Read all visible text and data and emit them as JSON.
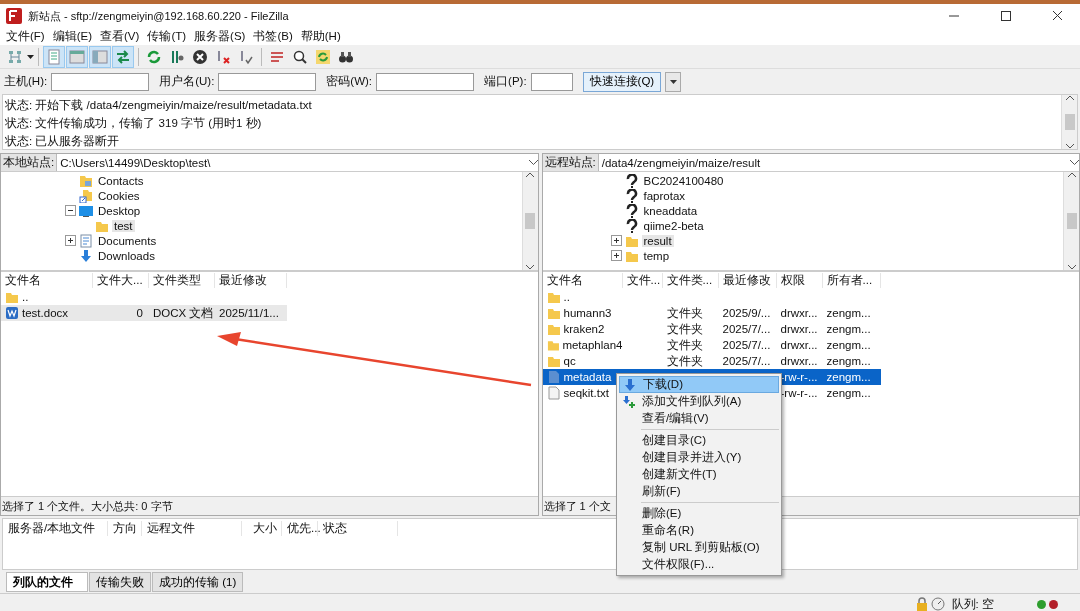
{
  "window": {
    "title": "新站点 - sftp://zengmeiyin@192.168.60.220 - FileZilla"
  },
  "menu": [
    "文件(F)",
    "编辑(E)",
    "查看(V)",
    "传输(T)",
    "服务器(S)",
    "书签(B)",
    "帮助(H)"
  ],
  "toolbar": [
    {
      "pressed": false
    },
    {
      "pressed": true
    },
    {
      "pressed": true
    },
    {
      "pressed": true
    },
    {
      "pressed": true
    },
    {
      "pressed": false
    },
    {
      "pressed": false
    },
    {
      "pressed": false
    },
    {
      "pressed": false
    },
    {
      "pressed": false
    },
    {
      "pressed": false
    },
    {
      "pressed": false
    },
    {
      "pressed": false
    },
    {
      "pressed": false
    }
  ],
  "quickconnect": {
    "fields": [
      {
        "label": "主机(H):"
      },
      {
        "label": "用户名(U):"
      },
      {
        "label": "密码(W):"
      },
      {
        "label": "端口(P):"
      }
    ],
    "button": "快速连接(Q)"
  },
  "log": [
    "状态: 开始下载 /data4/zengmeiyin/maize/result/metadata.txt",
    "状态: 文件传输成功，传输了 319 字节 (用时1 秒)",
    "状态: 已从服务器断开"
  ],
  "local": {
    "site_label": "本地站点:",
    "path": "C:\\Users\\14499\\Desktop\\test\\",
    "tree": [
      {
        "label": "Contacts",
        "kind": "contacts",
        "selected": false
      },
      {
        "label": "Cookies",
        "kind": "shortcut",
        "selected": false
      },
      {
        "label": "Desktop",
        "kind": "desktop",
        "expanded": true,
        "selected": false,
        "children": [
          {
            "label": "test",
            "kind": "folder",
            "selected": true
          }
        ]
      },
      {
        "label": "Documents",
        "kind": "document",
        "expanded": false,
        "selected": false
      },
      {
        "label": "Downloads",
        "kind": "download",
        "selected": false
      }
    ],
    "columns": [
      "文件名",
      "文件大...",
      "文件类型",
      "最近修改"
    ],
    "rows": [
      {
        "kind": "folder",
        "selected": false,
        "cells": [
          ".."
        ]
      },
      {
        "kind": "word",
        "selected": true,
        "cells": [
          "test.docx",
          "0",
          "DOCX 文档",
          "2025/11/1..."
        ]
      }
    ],
    "status": "选择了 1 个文件。大小总共: 0 字节"
  },
  "remote": {
    "site_label": "远程站点:",
    "path": "/data4/zengmeiyin/maize/result",
    "tree": [
      {
        "label": "BC2024100480",
        "kind": "unknown",
        "selected": false
      },
      {
        "label": "faprotax",
        "kind": "unknown",
        "selected": false
      },
      {
        "label": "kneaddata",
        "kind": "unknown",
        "selected": false
      },
      {
        "label": "qiime2-beta",
        "kind": "unknown",
        "selected": false
      },
      {
        "label": "result",
        "kind": "folder",
        "expanded": false,
        "selected": true
      },
      {
        "label": "temp",
        "kind": "folder",
        "expanded": false,
        "selected": false
      }
    ],
    "columns": [
      "文件名",
      "文件...",
      "文件类...",
      "最近修改",
      "权限",
      "所有者..."
    ],
    "rows": [
      {
        "kind": "folder",
        "selected": false,
        "cells": [
          ".."
        ]
      },
      {
        "kind": "folder",
        "selected": false,
        "cells": [
          "humann3",
          null,
          "文件夹",
          "2025/9/...",
          "drwxr...",
          "zengm..."
        ]
      },
      {
        "kind": "folder",
        "selected": false,
        "cells": [
          "kraken2",
          null,
          "文件夹",
          "2025/7/...",
          "drwxr...",
          "zengm..."
        ]
      },
      {
        "kind": "folder",
        "selected": false,
        "cells": [
          "metaphlan4",
          null,
          "文件夹",
          "2025/7/...",
          "drwxr...",
          "zengm..."
        ]
      },
      {
        "kind": "folder",
        "selected": false,
        "cells": [
          "qc",
          null,
          "文件夹",
          "2025/7/...",
          "drwxr...",
          "zengm..."
        ]
      },
      {
        "kind": "text",
        "selected": true,
        "cells": [
          "metadata",
          null,
          null,
          null,
          "-rw-r-...",
          "zengm..."
        ]
      },
      {
        "kind": "file",
        "selected": false,
        "cells": [
          "seqkit.txt",
          null,
          null,
          null,
          "-rw-r-...",
          "zengm..."
        ]
      }
    ],
    "status": "选择了 1 个文"
  },
  "context_menu": [
    {
      "label": "下载(D)",
      "kind": "download",
      "selected": true
    },
    {
      "label": "添加文件到队列(A)",
      "kind": "queue",
      "selected": false
    },
    {
      "label": "查看/编辑(V)",
      "kind": "plain",
      "selected": false
    },
    {
      "kind": "separator"
    },
    {
      "label": "创建目录(C)",
      "kind": "plain",
      "selected": false
    },
    {
      "label": "创建目录并进入(Y)",
      "kind": "plain",
      "selected": false
    },
    {
      "label": "创建新文件(T)",
      "kind": "plain",
      "selected": false
    },
    {
      "label": "刷新(F)",
      "kind": "plain",
      "selected": false
    },
    {
      "kind": "separator"
    },
    {
      "label": "删除(E)",
      "kind": "plain",
      "selected": false
    },
    {
      "label": "重命名(R)",
      "kind": "plain",
      "selected": false
    },
    {
      "label": "复制 URL 到剪贴板(O)",
      "kind": "plain",
      "selected": false
    },
    {
      "label": "文件权限(F)...",
      "kind": "plain",
      "selected": false
    }
  ],
  "queue": {
    "columns": [
      "服务器/本地文件",
      "方向",
      "远程文件",
      "大小",
      "优先...",
      "状态"
    ]
  },
  "queue_tabs": [
    {
      "label": "列队的文件",
      "selected": true
    },
    {
      "label": "传输失败",
      "selected": false
    },
    {
      "label": "成功的传输 (1)",
      "selected": false
    }
  ],
  "status_bar": {
    "queue": "队列: 空",
    "lights": [
      {
        "color": "#2e9e2e"
      },
      {
        "color": "#b3202a"
      }
    ]
  },
  "annotations": [
    {
      "kind": "arrow",
      "color": "#e8452e"
    }
  ]
}
